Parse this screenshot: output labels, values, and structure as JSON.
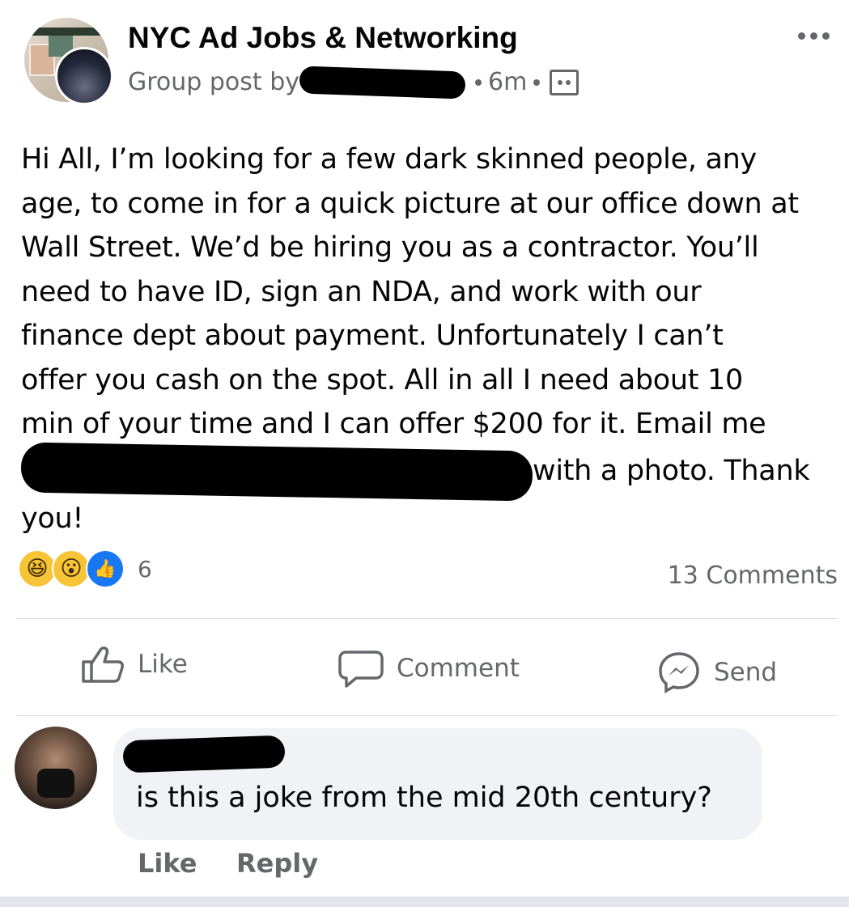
{
  "header": {
    "group_name": "NYC Ad Jobs & Networking",
    "group_post_by": "Group post by",
    "time_ago": "6m",
    "privacy_icon": "group-members-icon",
    "more_icon": "more-options-icon"
  },
  "post": {
    "lines": [
      "Hi All, I’m looking for a few dark skinned people, any",
      "age, to come in for a quick picture at our office down at",
      "Wall Street. We’d be hiring you as a contractor. You’ll",
      "need to have ID, sign an NDA, and work with our",
      "finance dept about payment. Unfortunately I can’t",
      "offer you cash on the spot. All in all I need about 10",
      "min of your time and I can offer $200 for it. Email me"
    ],
    "after_redaction": "with a photo. Thank",
    "last_line": "you!"
  },
  "stats": {
    "reaction_icons": [
      "laugh-reaction-icon",
      "wow-reaction-icon",
      "like-reaction-icon"
    ],
    "reaction_count": "6",
    "comments": "13 Comments"
  },
  "actions": {
    "like": "Like",
    "comment": "Comment",
    "send": "Send"
  },
  "comment": {
    "text": "is this a joke from the mid 20th century?",
    "like": "Like",
    "reply": "Reply"
  },
  "colors": {
    "text": "#050505",
    "secondary": "#65676b",
    "bubble": "#f0f2f5",
    "like_blue": "#1877f2",
    "reaction_yellow": "#f7c437"
  }
}
